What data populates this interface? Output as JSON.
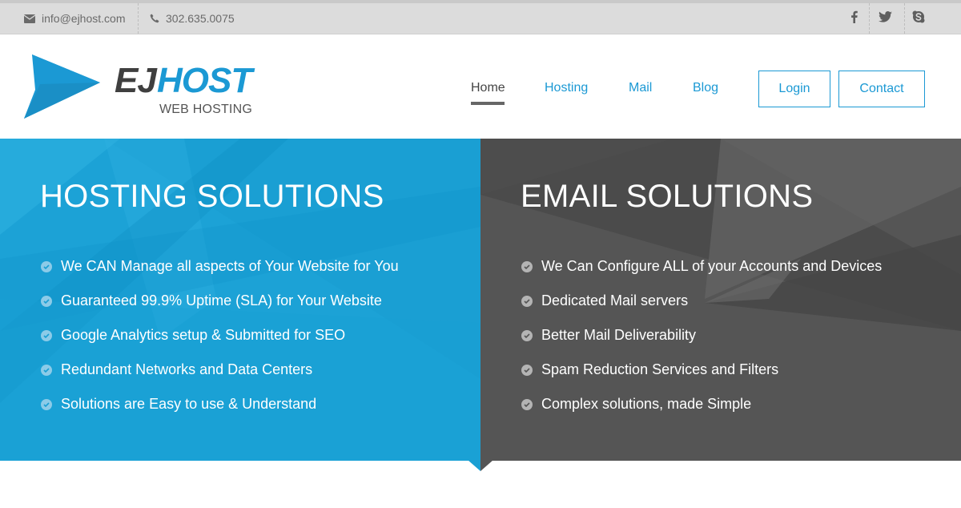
{
  "topbar": {
    "email": "info@ejhost.com",
    "phone": "302.635.0075",
    "social": [
      {
        "name": "facebook",
        "icon": "facebook-icon"
      },
      {
        "name": "twitter",
        "icon": "twitter-icon"
      },
      {
        "name": "skype",
        "icon": "skype-icon"
      }
    ]
  },
  "header": {
    "logo": {
      "part1": "EJ",
      "part2": "HOST",
      "tagline": "WEB HOSTING"
    },
    "nav": [
      {
        "label": "Home",
        "active": true
      },
      {
        "label": "Hosting",
        "active": false
      },
      {
        "label": "Mail",
        "active": false
      },
      {
        "label": "Blog",
        "active": false
      }
    ],
    "buttons": {
      "login": "Login",
      "contact": "Contact"
    }
  },
  "colors": {
    "brand_blue": "#1b99d4",
    "dark_gray": "#555555",
    "topbar_bg": "#dcdcdc"
  },
  "hosting": {
    "title": "HOSTING SOLUTIONS",
    "items": [
      "We CAN Manage all aspects of Your Website for You",
      "Guaranteed 99.9% Uptime (SLA) for Your Website",
      "Google Analytics setup & Submitted for SEO",
      "Redundant Networks and Data Centers",
      "Solutions are Easy to use & Understand"
    ]
  },
  "email": {
    "title": "EMAIL SOLUTIONS",
    "items": [
      "We Can Configure ALL of your Accounts and Devices",
      "Dedicated Mail servers",
      "Better Mail Deliverability",
      "Spam Reduction Services and Filters",
      "Complex solutions, made Simple"
    ]
  }
}
